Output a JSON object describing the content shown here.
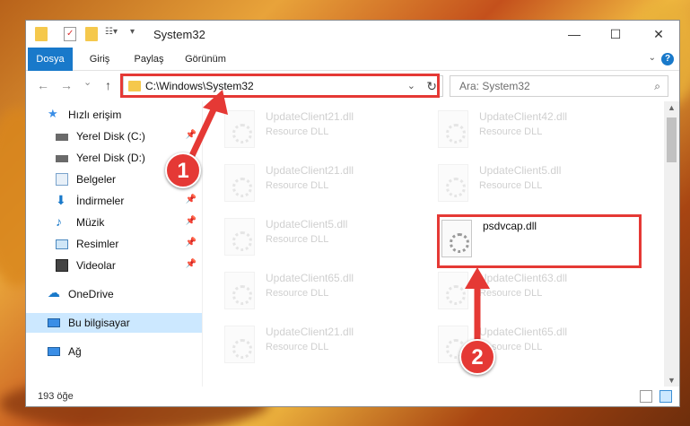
{
  "window": {
    "title": "System32",
    "controls": {
      "minimize": "—",
      "maximize": "☐",
      "close": "✕"
    }
  },
  "ribbon": {
    "tabs": [
      "Dosya",
      "Giriş",
      "Paylaş",
      "Görünüm"
    ],
    "help": "?"
  },
  "navigation": {
    "back": "←",
    "forward": "→",
    "recent": "⌄",
    "up": "↑",
    "address": "C:\\Windows\\System32",
    "search_placeholder": "Ara: System32"
  },
  "sidebar": {
    "items": [
      {
        "label": "Hızlı erişim",
        "icon": "star-icon"
      },
      {
        "label": "Yerel Disk (C:)",
        "icon": "drive-icon",
        "pinned": true
      },
      {
        "label": "Yerel Disk (D:)",
        "icon": "drive-icon",
        "pinned": true
      },
      {
        "label": "Belgeler",
        "icon": "document-icon",
        "pinned": true
      },
      {
        "label": "İndirmeler",
        "icon": "download-icon",
        "pinned": true
      },
      {
        "label": "Müzik",
        "icon": "music-icon",
        "pinned": true
      },
      {
        "label": "Resimler",
        "icon": "picture-icon",
        "pinned": true
      },
      {
        "label": "Videolar",
        "icon": "video-icon",
        "pinned": true
      },
      {
        "label": "OneDrive",
        "icon": "cloud-icon"
      },
      {
        "label": "Bu bilgisayar",
        "icon": "computer-icon",
        "selected": true
      },
      {
        "label": "Ağ",
        "icon": "network-icon"
      }
    ]
  },
  "files": [
    {
      "name": "UpdateClient21.dll",
      "type": "Resource DLL"
    },
    {
      "name": "UpdateClient42.dll",
      "type": "Resource DLL"
    },
    {
      "name": "UpdateClient21.dll",
      "type": "Resource DLL"
    },
    {
      "name": "UpdateClient5.dll",
      "type": "Resource DLL"
    },
    {
      "name": "UpdateClient5.dll",
      "type": "Resource DLL"
    },
    {
      "name": "psdvcap.dll",
      "type": "",
      "highlighted": true
    },
    {
      "name": "UpdateClient65.dll",
      "type": "Resource DLL"
    },
    {
      "name": "UpdateClient63.dll",
      "type": "Resource DLL"
    },
    {
      "name": "UpdateClient21.dll",
      "type": "Resource DLL"
    },
    {
      "name": "UpdateClient65.dll",
      "type": "Resource DLL"
    }
  ],
  "status": {
    "count": "193 öğe"
  },
  "annotations": {
    "step1": "1",
    "step2": "2",
    "color": "#e53935"
  }
}
